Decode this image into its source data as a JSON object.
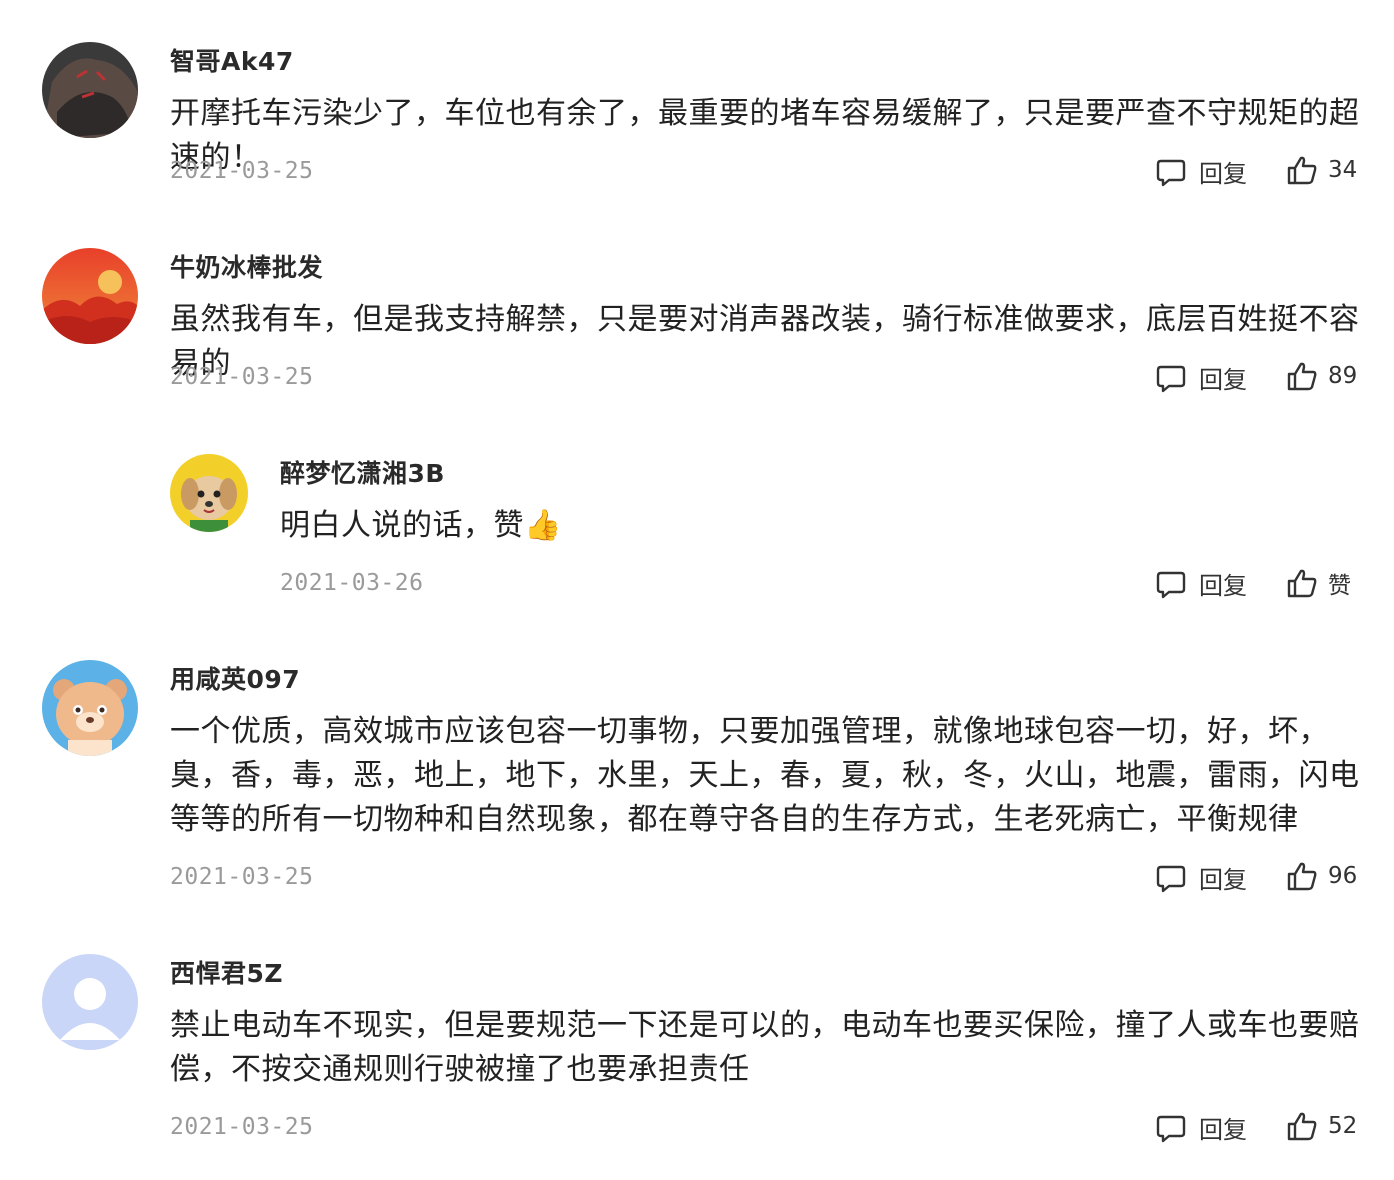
{
  "comments": [
    {
      "username": "智哥Ak47",
      "content": "开摩托车污染少了，车位也有余了，最重要的堵车容易缓解了，只是要严查不守规矩的超速的！",
      "date": "2021-03-25",
      "reply_label": "回复",
      "likes": "34",
      "avatar": "dark-rock-icon"
    },
    {
      "username": "牛奶冰棒批发",
      "content": "虽然我有车，但是我支持解禁，只是要对消声器改装，骑行标准做要求，底层百姓挺不容易的",
      "date": "2021-03-25",
      "reply_label": "回复",
      "likes": "89",
      "avatar": "sunset-icon"
    },
    {
      "username": "醉梦忆潇湘3B",
      "content": "明白人说的话，赞",
      "emoji": "👍",
      "date": "2021-03-26",
      "reply_label": "回复",
      "likes": "赞",
      "avatar": "dog-icon"
    },
    {
      "username": "用咸英097",
      "content": "一个优质，高效城市应该包容一切事物，只要加强管理，就像地球包容一切，好，坏，臭，香，毒，恶，地上，地下，水里，天上，春，夏，秋，冬，火山，地震，雷雨，闪电等等的所有一切物种和自然现象，都在尊守各自的生存方式，生老死病亡，平衡规律",
      "date": "2021-03-25",
      "reply_label": "回复",
      "likes": "96",
      "avatar": "bear-icon"
    },
    {
      "username": "西悍君5Z",
      "content": "禁止电动车不现实，但是要规范一下还是可以的，电动车也要买保险，撞了人或车也要赔偿，不按交通规则行驶被撞了也要承担责任",
      "date": "2021-03-25",
      "reply_label": "回复",
      "likes": "52",
      "avatar": "default-user-icon"
    }
  ],
  "colors": {
    "text": "#222222",
    "date": "#9a9a9a",
    "icon": "#333333",
    "emoji": "#f5b400"
  }
}
